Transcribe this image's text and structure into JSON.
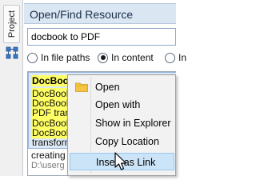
{
  "sidebar": {
    "tab_label": "Project"
  },
  "panel": {
    "title": "Open/Find Resource",
    "search": {
      "value": "docbook to PDF"
    },
    "radio_options": [
      {
        "label": "In file paths",
        "checked": false
      },
      {
        "label": "In content",
        "checked": true
      },
      {
        "label": "In",
        "checked": false
      }
    ]
  },
  "results": {
    "title": "DocBook",
    "lines": [
      "DocBook",
      "DocBook",
      "PDF trans",
      "DocBook",
      "DocBook",
      "transform",
      "creating a"
    ],
    "path": "D:\\userg"
  },
  "context_menu": {
    "items": [
      {
        "label": "Open",
        "icon": "folder-icon",
        "highlighted": false
      },
      {
        "label": "Open with",
        "highlighted": false
      },
      {
        "label": "Show in Explorer",
        "highlighted": false
      },
      {
        "label": "Copy Location",
        "highlighted": false
      },
      {
        "label": "Insert as Link",
        "highlighted": true
      }
    ]
  },
  "colors": {
    "header_bg": "#dbe6f3",
    "selection_bg": "#dce8f5",
    "highlight": "#ffff66",
    "menu_hover": "#cce4f7"
  }
}
